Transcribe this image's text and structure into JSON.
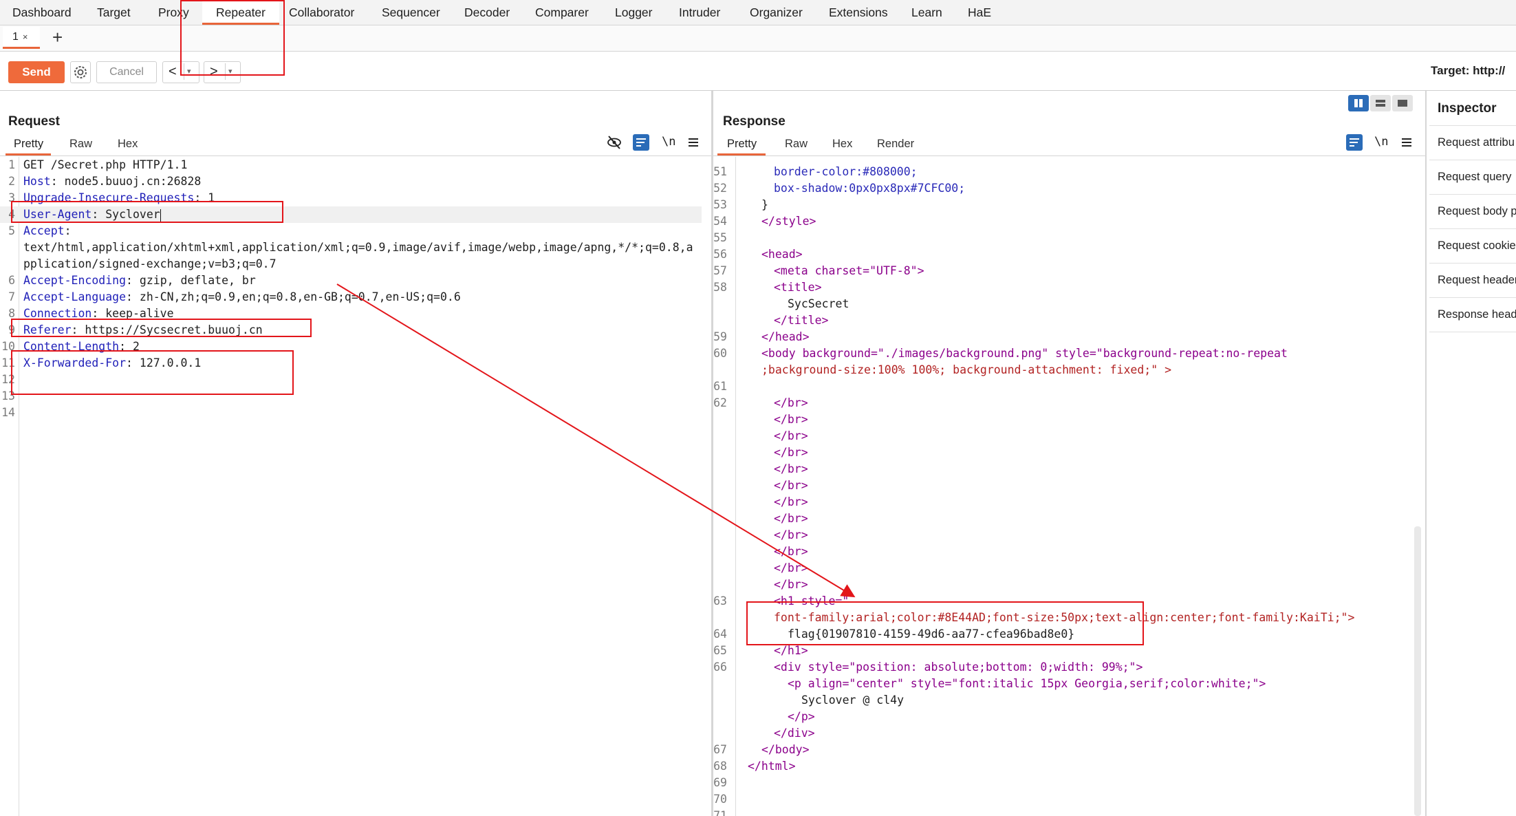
{
  "menu": {
    "items": [
      "Dashboard",
      "Target",
      "Proxy",
      "Repeater",
      "Collaborator",
      "Sequencer",
      "Decoder",
      "Comparer",
      "Logger",
      "Intruder",
      "Organizer",
      "Extensions",
      "Learn",
      "HaE"
    ],
    "active": "Repeater"
  },
  "tabs": {
    "current_label": "1",
    "close": "×",
    "add": "+"
  },
  "toolbar": {
    "send_label": "Send",
    "cancel_label": "Cancel",
    "back_label": "<",
    "forward_label": ">",
    "dropdown": "▾",
    "target_label": "Target: http://"
  },
  "request": {
    "title": "Request",
    "tabs": [
      "Pretty",
      "Raw",
      "Hex"
    ],
    "active_tab": "Pretty",
    "lines": [
      {
        "n": "1",
        "h": "",
        "v": "GET /Secret.php HTTP/1.1"
      },
      {
        "n": "2",
        "h": "Host",
        "v": " node5.buuoj.cn:26828"
      },
      {
        "n": "3",
        "h": "Upgrade-Insecure-Requests",
        "v": " 1"
      },
      {
        "n": "4",
        "h": "User-Agent",
        "v": " Syclover"
      },
      {
        "n": "5",
        "h": "Accept",
        "v": ""
      },
      {
        "n": "",
        "h": "",
        "v": "text/html,application/xhtml+xml,application/xml;q=0.9,image/avif,image/webp,image/apng,*/*;q=0.8,a"
      },
      {
        "n": "",
        "h": "",
        "v": "pplication/signed-exchange;v=b3;q=0.7"
      },
      {
        "n": "6",
        "h": "Accept-Encoding",
        "v": " gzip, deflate, br"
      },
      {
        "n": "7",
        "h": "Accept-Language",
        "v": " zh-CN,zh;q=0.9,en;q=0.8,en-GB;q=0.7,en-US;q=0.6"
      },
      {
        "n": "8",
        "h": "Connection",
        "v": " keep-alive"
      },
      {
        "n": "9",
        "h": "Referer",
        "v": " https://Sycsecret.buuoj.cn"
      },
      {
        "n": "10",
        "h": "Content-Length",
        "v": " 2"
      },
      {
        "n": "11",
        "h": "X-Forwarded-For",
        "v": " 127.0.0.1"
      },
      {
        "n": "12",
        "h": "",
        "v": ""
      },
      {
        "n": "13",
        "h": "",
        "v": ""
      },
      {
        "n": "14",
        "h": "",
        "v": ""
      }
    ]
  },
  "response": {
    "title": "Response",
    "tabs": [
      "Pretty",
      "Raw",
      "Hex",
      "Render"
    ],
    "active_tab": "Pretty",
    "lines": [
      {
        "n": "51",
        "c": "border-color:#808000;",
        "t": "css"
      },
      {
        "n": "52",
        "c": "box-shadow:0px0px8px#7CFC00;",
        "t": "css"
      },
      {
        "n": "53",
        "c": "}",
        "t": "txt"
      },
      {
        "n": "54",
        "c": "</style>",
        "t": "tag"
      },
      {
        "n": "55",
        "c": "",
        "t": "txt"
      },
      {
        "n": "56",
        "c": "<head>",
        "t": "tag"
      },
      {
        "n": "57",
        "c": "<meta charset=\"UTF-8\">",
        "t": "tag"
      },
      {
        "n": "58",
        "c": "<title>",
        "t": "tag"
      },
      {
        "n": "",
        "c": "SycSecret",
        "t": "txt"
      },
      {
        "n": "",
        "c": "</title>",
        "t": "tag"
      },
      {
        "n": "59",
        "c": "</head>",
        "t": "tag"
      },
      {
        "n": "60",
        "c": "<body background=\"./images/background.png\" style=\"background-repeat:no-repeat",
        "t": "tag"
      },
      {
        "n": "",
        "c": ";background-size:100% 100%; background-attachment: fixed;\" >",
        "t": "val"
      },
      {
        "n": "61",
        "c": "",
        "t": "txt"
      },
      {
        "n": "62",
        "c": "</br>",
        "t": "tag"
      },
      {
        "n": "",
        "c": "</br>",
        "t": "tag"
      },
      {
        "n": "",
        "c": "</br>",
        "t": "tag"
      },
      {
        "n": "",
        "c": "</br>",
        "t": "tag"
      },
      {
        "n": "",
        "c": "</br>",
        "t": "tag"
      },
      {
        "n": "",
        "c": "</br>",
        "t": "tag"
      },
      {
        "n": "",
        "c": "</br>",
        "t": "tag"
      },
      {
        "n": "",
        "c": "</br>",
        "t": "tag"
      },
      {
        "n": "",
        "c": "</br>",
        "t": "tag"
      },
      {
        "n": "",
        "c": "</br>",
        "t": "tag"
      },
      {
        "n": "",
        "c": "</br>",
        "t": "tag"
      },
      {
        "n": "",
        "c": "</br>",
        "t": "tag"
      },
      {
        "n": "63",
        "c": "<h1 style=\"",
        "t": "tag"
      },
      {
        "n": "",
        "c": "font-family:arial;color:#8E44AD;font-size:50px;text-align:center;font-family:KaiTi;\">",
        "t": "val"
      },
      {
        "n": "64",
        "c": "flag{01907810-4159-49d6-aa77-cfea96bad8e0}",
        "t": "txt"
      },
      {
        "n": "65",
        "c": "</h1>",
        "t": "tag"
      },
      {
        "n": "66",
        "c": "<div style=\"position: absolute;bottom: 0;width: 99%;\">",
        "t": "tag"
      },
      {
        "n": "",
        "c": "<p align=\"center\" style=\"font:italic 15px Georgia,serif;color:white;\">",
        "t": "tag"
      },
      {
        "n": "",
        "c": "Syclover @ cl4y",
        "t": "txt"
      },
      {
        "n": "",
        "c": "</p>",
        "t": "tag"
      },
      {
        "n": "",
        "c": "</div>",
        "t": "tag"
      },
      {
        "n": "67",
        "c": "</body>",
        "t": "tag"
      },
      {
        "n": "68",
        "c": "</html>",
        "t": "tag"
      },
      {
        "n": "69",
        "c": "",
        "t": "txt"
      },
      {
        "n": "70",
        "c": "",
        "t": "txt"
      },
      {
        "n": "71",
        "c": "",
        "t": "txt"
      }
    ]
  },
  "inspector": {
    "title": "Inspector",
    "items": [
      "Request attribu",
      "Request query",
      "Request body p",
      "Request cookie",
      "Request header",
      "Response head"
    ]
  },
  "colors": {
    "accent": "#e8653a",
    "send": "#ef6a3b",
    "annotation": "#e3151a",
    "blue": "#2b6cb8"
  }
}
